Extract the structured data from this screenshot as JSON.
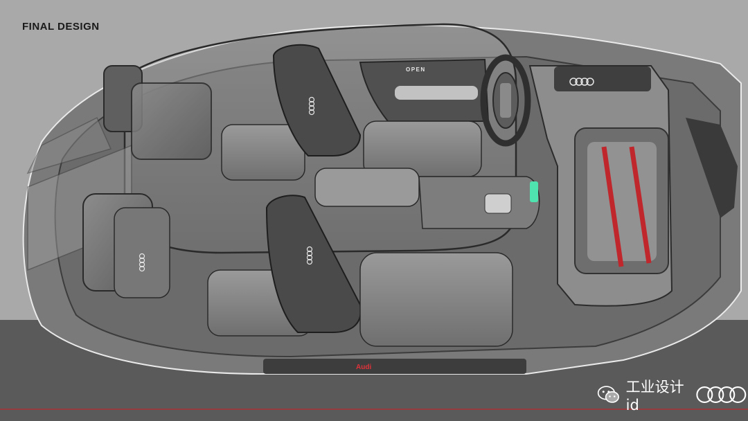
{
  "title": "FINAL DESIGN",
  "labels": {
    "dash": "OPEN",
    "sill_brand": "Audi"
  },
  "watermark": {
    "text": "工业设计id",
    "icon": "wechat-icon",
    "logo": "four-rings-logo"
  },
  "colors": {
    "background": "#a9a9a9",
    "floor": "#555555",
    "accent_red": "#c0272d",
    "ambient_green": "#4fe3b0"
  }
}
